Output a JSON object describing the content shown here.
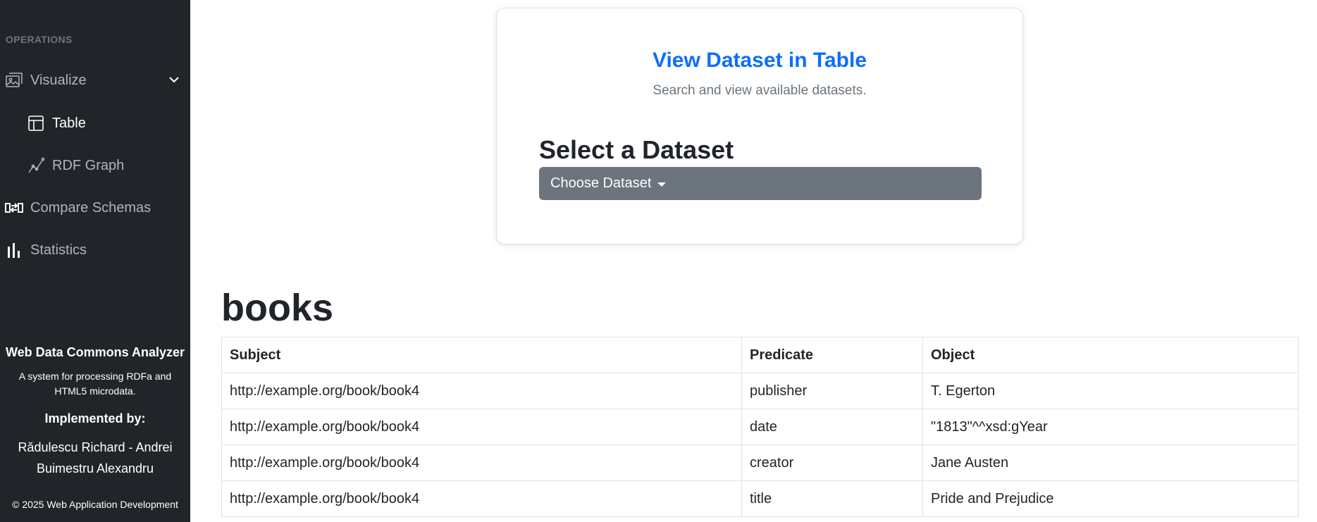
{
  "sidebar": {
    "section_label": "OPERATIONS",
    "items": [
      {
        "label": "Visualize",
        "icon": "image-icon"
      },
      {
        "label": "Table",
        "icon": "table-icon"
      },
      {
        "label": "RDF Graph",
        "icon": "graph-icon"
      },
      {
        "label": "Compare Schemas",
        "icon": "compare-icon"
      },
      {
        "label": "Statistics",
        "icon": "bar-chart-icon"
      }
    ],
    "footer": {
      "title": "Web Data Commons Analyzer",
      "description": "A system for processing RDFa and HTML5 microdata.",
      "implemented_label": "Implemented by:",
      "author1": "Rădulescu Richard - Andrei",
      "author2": "Buimestru Alexandru",
      "copyright": "© 2025 Web Application Development"
    }
  },
  "card": {
    "title": "View Dataset in Table",
    "subtitle": "Search and view available datasets.",
    "heading": "Select a Dataset",
    "dropdown_label": "Choose Dataset"
  },
  "dataset": {
    "name": "books",
    "headers": [
      "Subject",
      "Predicate",
      "Object"
    ],
    "rows": [
      [
        "http://example.org/book/book4",
        "publisher",
        "T. Egerton"
      ],
      [
        "http://example.org/book/book4",
        "date",
        "\"1813\"^^xsd:gYear"
      ],
      [
        "http://example.org/book/book4",
        "creator",
        "Jane Austen"
      ],
      [
        "http://example.org/book/book4",
        "title",
        "Pride and Prejudice"
      ]
    ]
  },
  "colors": {
    "sidebar_bg": "#212529",
    "accent": "#0d6efd",
    "button_bg": "#6c757d"
  }
}
